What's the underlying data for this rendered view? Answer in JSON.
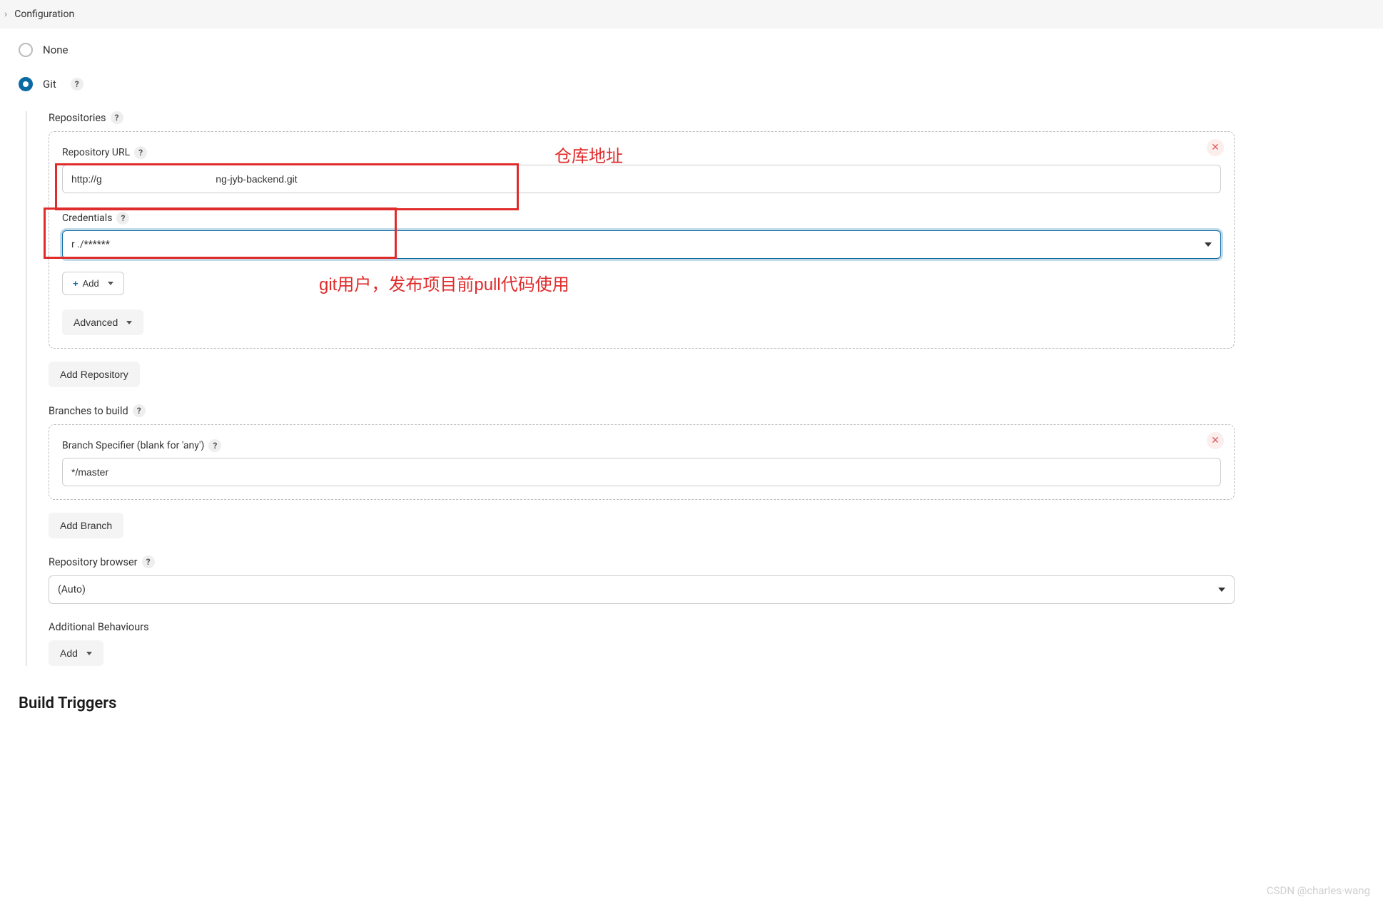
{
  "breadcrumb": {
    "current": "Configuration"
  },
  "scm": {
    "none_label": "None",
    "git_label": "Git",
    "repositories_label": "Repositories",
    "repo_url_label": "Repository URL",
    "repo_url_value": "http://g                                         ng-jyb-backend.git",
    "credentials_label": "Credentials",
    "credentials_value": "r      ./******",
    "add_button": "Add",
    "advanced_button": "Advanced",
    "add_repository_button": "Add Repository",
    "branches_label": "Branches to build",
    "branch_specifier_label": "Branch Specifier (blank for 'any')",
    "branch_specifier_value": "*/master",
    "add_branch_button": "Add Branch",
    "repo_browser_label": "Repository browser",
    "repo_browser_value": "(Auto)",
    "additional_behaviours_label": "Additional Behaviours",
    "additional_add_button": "Add"
  },
  "triggers": {
    "title": "Build Triggers"
  },
  "annotations": {
    "repo_url_note": "仓库地址",
    "credentials_note": "git用户，发布项目前pull代码使用"
  },
  "watermark": "CSDN @charles·wang"
}
